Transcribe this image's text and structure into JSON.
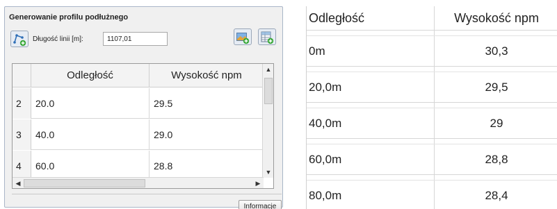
{
  "panel": {
    "title": "Generowanie profilu podłużnego",
    "length_label": "Długość linii [m]:",
    "length_value": "1107,01",
    "info_button": "Informacje",
    "table": {
      "columns": [
        "Odległość",
        "Wysokość npm"
      ],
      "rows": [
        {
          "num": "2",
          "distance": "20.0",
          "height": "29.5"
        },
        {
          "num": "3",
          "distance": "40.0",
          "height": "29.0"
        },
        {
          "num": "4",
          "distance": "60.0",
          "height": "28.8"
        }
      ]
    },
    "icons": {
      "line_tool": "add-line-icon",
      "image_export": "add-image-icon",
      "table_export": "add-table-icon"
    }
  },
  "sheet": {
    "columns": [
      "Odległość",
      "Wysokość npm"
    ],
    "rows": [
      {
        "distance": "0m",
        "height": "30,3"
      },
      {
        "distance": "20,0m",
        "height": "29,5"
      },
      {
        "distance": "40,0m",
        "height": "29"
      },
      {
        "distance": "60,0m",
        "height": "28,8"
      },
      {
        "distance": "80,0m",
        "height": "28,4"
      }
    ]
  },
  "colors": {
    "panel_border": "#a9b6c8",
    "grid_line": "#d6d6d6",
    "icon_green": "#3aa83a",
    "icon_blue": "#2f6fb7"
  }
}
